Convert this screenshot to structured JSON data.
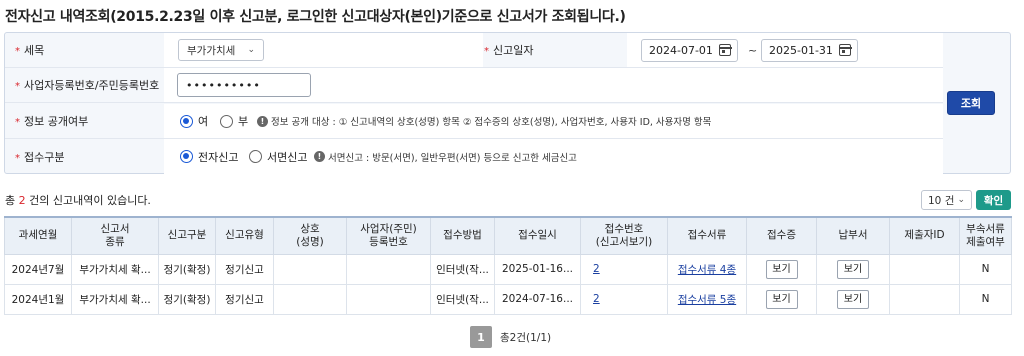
{
  "title": "전자신고 내역조회(2015.2.23일 이후 신고분, 로그인한 신고대상자(본인)기준으로 신고서가 조회됩니다.)",
  "search": {
    "tax_type": {
      "label": "세목",
      "value": "부가가치세"
    },
    "report_date": {
      "label": "신고일자",
      "from": "2024-07-01",
      "to": "2025-01-31",
      "sep": "~"
    },
    "biz_no": {
      "label": "사업자등록번호/주민등록번호",
      "value": "••••••••••"
    },
    "disclosure": {
      "label": "정보 공개여부",
      "opt_yes": "여",
      "opt_no": "부",
      "note": "정보 공개 대상 : ① 신고내역의 상호(성명) 항목 ② 접수증의 상호(성명), 사업자번호, 사용자 ID, 사용자명 항목"
    },
    "receipt_type": {
      "label": "접수구분",
      "opt_electronic": "전자신고",
      "opt_paper": "서면신고",
      "note": "서면신고 : 방문(서면), 일반우편(서면) 등으로 신고한 세금신고"
    },
    "required_mark": "*",
    "info_mark": "!",
    "button": "조회"
  },
  "result": {
    "count_prefix": "총 ",
    "count_value": "2",
    "count_suffix": " 건의 신고내역이 있습니다.",
    "page_size": "10 건",
    "confirm_button": "확인"
  },
  "table": {
    "headers": {
      "h1": "과세연월",
      "h2a": "신고서",
      "h2b": "종류",
      "h3": "신고구분",
      "h4": "신고유형",
      "h5a": "상호",
      "h5b": "(성명)",
      "h6a": "사업자(주민)",
      "h6b": "등록번호",
      "h7": "접수방법",
      "h8": "접수일시",
      "h9a": "접수번호",
      "h9b": "(신고서보기)",
      "h10": "접수서류",
      "h11": "접수증",
      "h12": "납부서",
      "h13": "제출자ID",
      "h14a": "부속서류",
      "h14b": "제출여부"
    },
    "rows": [
      {
        "period": "2024년7월",
        "form": "부가가치세 확...",
        "category": "정기(확정)",
        "type": "정기신고",
        "name": "",
        "bizno": "",
        "method": "인터넷(작...",
        "datetime": "2025-01-16...",
        "receipt_no": "2",
        "docs": "접수서류 4종",
        "receipt_btn": "보기",
        "payment_btn": "보기",
        "submitter": "",
        "attached": "N"
      },
      {
        "period": "2024년1월",
        "form": "부가가치세 확...",
        "category": "정기(확정)",
        "type": "정기신고",
        "name": "",
        "bizno": "",
        "method": "인터넷(작...",
        "datetime": "2024-07-16...",
        "receipt_no": "2",
        "docs": "접수서류 5종",
        "receipt_btn": "보기",
        "payment_btn": "보기",
        "submitter": "",
        "attached": "N"
      }
    ]
  },
  "pager": {
    "current": "1",
    "total": "총2건(1/1)"
  },
  "icons": {
    "select_chevron": "chevron-down-icon",
    "date_picker": "calendar-icon",
    "info": "info-icon"
  },
  "colors": {
    "primary": "#1f4aa8",
    "confirm": "#1e9a8a",
    "required": "#d9272e",
    "link": "#1a3fa0"
  }
}
